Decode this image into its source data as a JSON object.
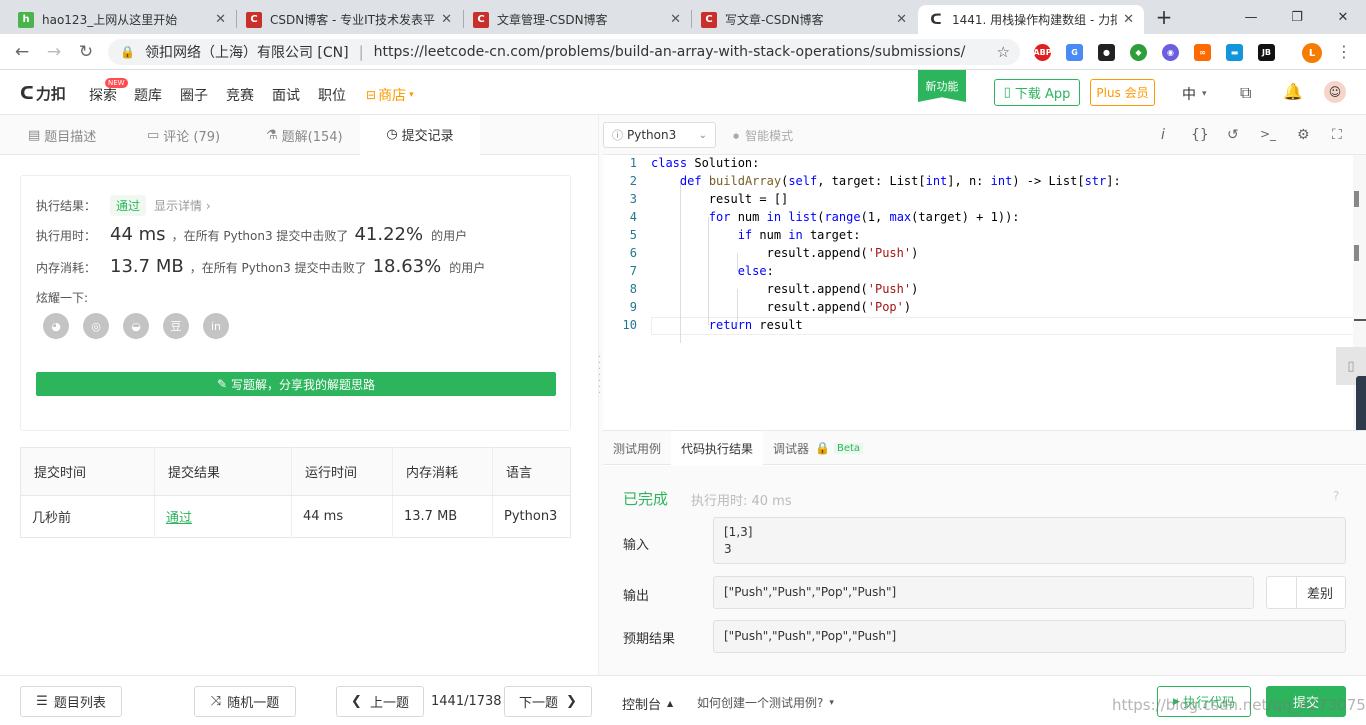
{
  "browser": {
    "tabs": [
      {
        "title": "hao123_上网从这里开始",
        "icon": "hao123-icon",
        "color": "#4bb34b"
      },
      {
        "title": "CSDN博客 - 专业IT技术发表平",
        "icon": "csdn-icon",
        "color": "#c9302c"
      },
      {
        "title": "文章管理-CSDN博客",
        "icon": "csdn-icon",
        "color": "#c9302c"
      },
      {
        "title": "写文章-CSDN博客",
        "icon": "csdn-icon",
        "color": "#c9302c"
      },
      {
        "title": "1441. 用栈操作构建数组 - 力扣",
        "icon": "leetcode-icon",
        "color": "#333333"
      }
    ],
    "new_tab": "+",
    "win_min": "—",
    "win_max": "❐",
    "win_close": "✕",
    "site_org": "领扣网络（上海）有限公司 [CN]",
    "url": "https://leetcode-cn.com/problems/build-an-array-with-stack-operations/submissions/",
    "extensions": [
      "ABP",
      "G",
      "●",
      "◆",
      "◉",
      "∞",
      "▬",
      "JB"
    ],
    "profile_initial": "L"
  },
  "header": {
    "logo": "力扣",
    "nav": [
      "探索",
      "题库",
      "圈子",
      "竞赛",
      "面试",
      "职位"
    ],
    "nav_new_badge": "NEW",
    "store": "商店",
    "new_feature": "新功能",
    "download_app": "下载 App",
    "plus": "Plus 会员",
    "lang": "中"
  },
  "panel_tabs": [
    "题目描述",
    "评论 (79)",
    "题解(154)",
    "提交记录"
  ],
  "result": {
    "status_label": "执行结果：",
    "status": "通过",
    "detail_link": "显示详情 ›",
    "time_label": "执行用时：",
    "time": "44 ms",
    "time_text": "，在所有 Python3 提交中击败了",
    "time_pct": "41.22%",
    "users": "的用户",
    "mem_label": "内存消耗：",
    "mem": "13.7 MB",
    "mem_text": "，在所有 Python3 提交中击败了",
    "mem_pct": "18.63%",
    "share_label": "炫耀一下:",
    "share_icons": [
      "wechat-icon",
      "weibo-icon",
      "qq-icon",
      "douban-icon",
      "linkedin-icon"
    ],
    "share_icon_glyphs": [
      "◕",
      "◎",
      "◒",
      "豆",
      "in"
    ],
    "write_solution": "写题解，分享我的解题思路"
  },
  "submissions": {
    "headers": [
      "提交时间",
      "提交结果",
      "运行时间",
      "内存消耗",
      "语言"
    ],
    "rows": [
      [
        "几秒前",
        "通过",
        "44 ms",
        "13.7 MB",
        "Python3"
      ]
    ]
  },
  "editor": {
    "language": "Python3",
    "smart_mode": "智能模式",
    "toolbar_icons": [
      "i",
      "{}",
      "↺",
      ">_",
      "⚙",
      "⛶"
    ]
  },
  "code_lines": [
    "1",
    "2",
    "3",
    "4",
    "5",
    "6",
    "7",
    "8",
    "9",
    "10"
  ],
  "bottom_tabs": [
    "测试用例",
    "代码执行结果",
    "调试器",
    "Beta"
  ],
  "run": {
    "done": "已完成",
    "time": "执行用时: 40 ms",
    "input_label": "输入",
    "input": [
      "[1,3]",
      "3"
    ],
    "output_label": "输出",
    "output": "[\"Push\",\"Push\",\"Pop\",\"Push\"]",
    "diff": "差别",
    "expected_label": "预期结果",
    "expected": "[\"Push\",\"Push\",\"Pop\",\"Push\"]"
  },
  "footer": {
    "problem_list": "题目列表",
    "random": "随机一题",
    "prev": "上一题",
    "counter": "1441/1738",
    "next": "下一题",
    "console": "控制台",
    "how_test": "如何创建一个测试用例?",
    "run_code": "执行代码",
    "submit": "提交",
    "watermark": "https://blog.csdn.net/qq_42730750"
  },
  "colors": {
    "accent": "#2db55d",
    "plus": "#ff9900",
    "badge": "#ff4d4f",
    "link": "#21a1ff"
  }
}
